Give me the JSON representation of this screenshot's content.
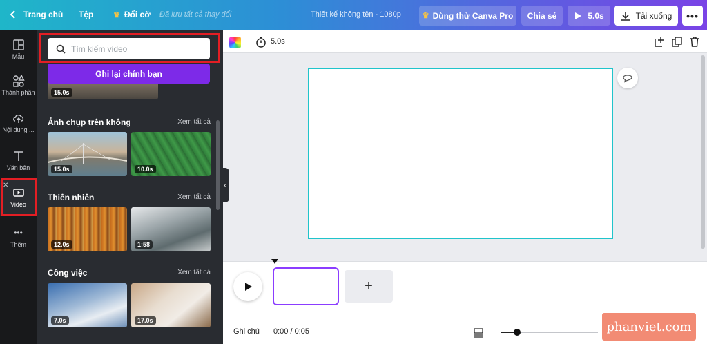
{
  "topbar": {
    "home_label": "Trang chủ",
    "file_label": "Tệp",
    "resize_label": "Đổi cỡ",
    "saved_status": "Đã lưu tất cả thay đổi",
    "design_title": "Thiết kế không tên - 1080p",
    "try_pro_label": "Dùng thử Canva Pro",
    "share_label": "Chia sẻ",
    "duration_label": "5.0s",
    "download_label": "Tải xuống"
  },
  "rail": {
    "items": [
      {
        "label": "Mẫu",
        "icon": "template-icon"
      },
      {
        "label": "Thành phần",
        "icon": "elements-icon"
      },
      {
        "label": "Nội dung ...",
        "icon": "upload-cloud-icon"
      },
      {
        "label": "Văn bản",
        "icon": "text-icon"
      },
      {
        "label": "Video",
        "icon": "video-icon"
      },
      {
        "label": "Thêm",
        "icon": "more-dots-icon"
      }
    ]
  },
  "panel": {
    "search_placeholder": "Tìm kiếm video",
    "record_label": "Ghi lại chính bạn",
    "top_clip_duration": "15.0s",
    "see_all_label": "Xem tất cả",
    "sections": [
      {
        "title": "Ảnh chụp trên không",
        "clips": [
          "15.0s",
          "10.0s"
        ]
      },
      {
        "title": "Thiên nhiên",
        "clips": [
          "12.0s",
          "1:58"
        ]
      },
      {
        "title": "Công việc",
        "clips": [
          "7.0s",
          "17.0s"
        ]
      }
    ]
  },
  "editor": {
    "page_duration": "5.0s"
  },
  "timeline": {
    "notes_label": "Ghi chú",
    "time_readout": "0:00 / 0:05"
  },
  "watermark": "phanviet.com",
  "colors": {
    "accent_purple": "#7d2ae8",
    "canvas_border": "#20c4cb",
    "highlight_red": "#e31e24"
  }
}
